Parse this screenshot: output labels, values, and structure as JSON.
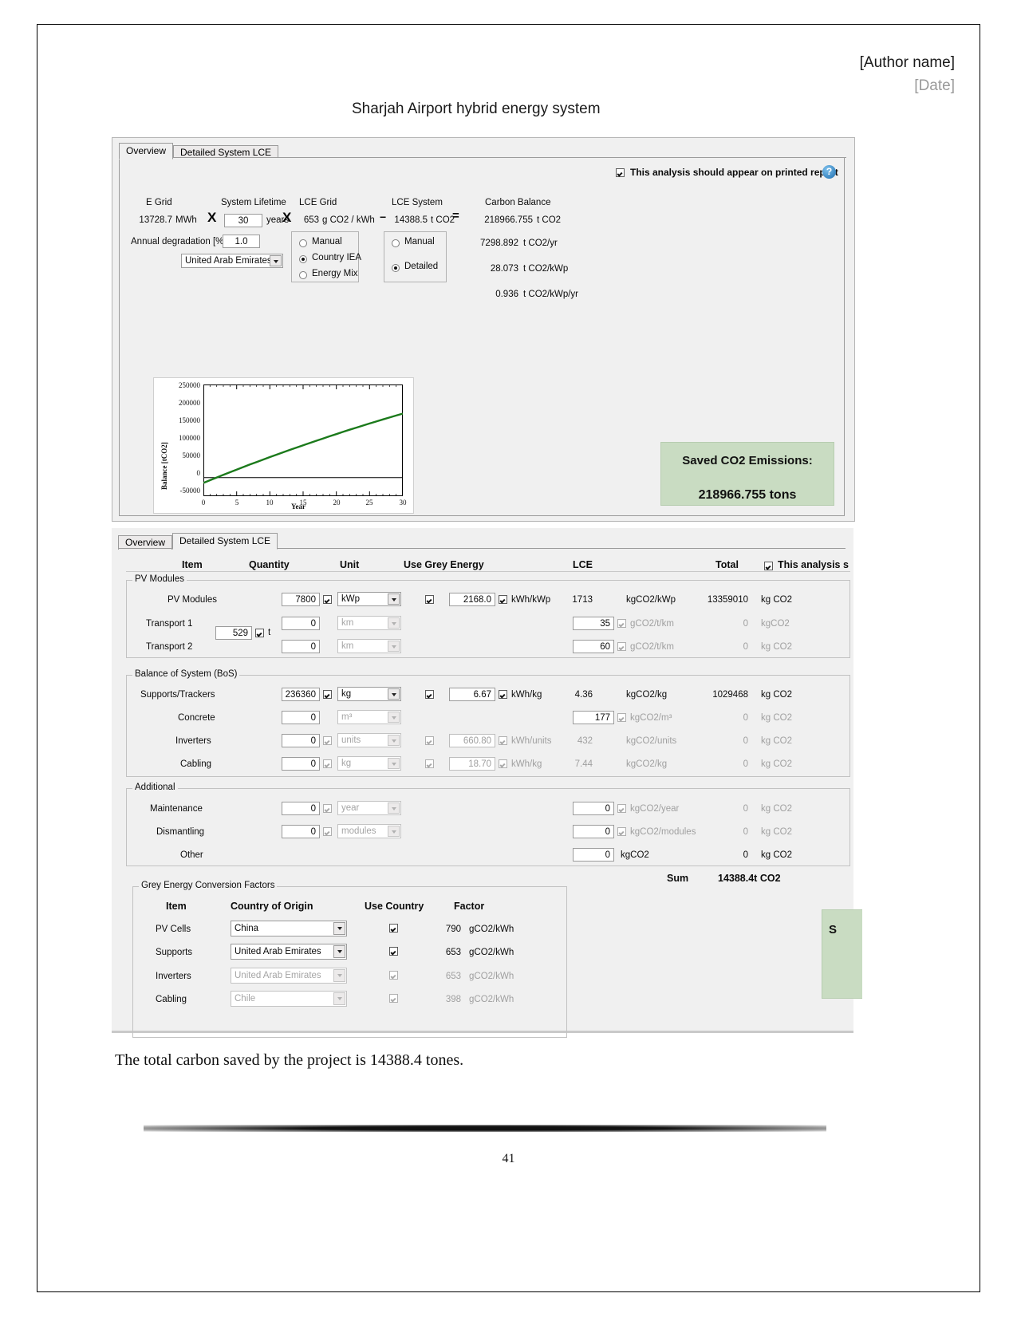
{
  "document": {
    "author": "[Author name]",
    "date": "[Date]",
    "title": "Sharjah Airport hybrid energy system",
    "caption": "The total carbon saved by the project is 14388.4 tones.",
    "page_number": "41"
  },
  "overview_panel": {
    "tabs": [
      {
        "label": "Overview",
        "active": true
      },
      {
        "label": "Detailed System LCE",
        "active": false
      }
    ],
    "print_checkbox": {
      "label": "This analysis should appear on printed report",
      "checked": true
    },
    "help_icon": "?",
    "fields": {
      "e_grid": {
        "label": "E Grid",
        "value": "13728.7",
        "unit": "MWh"
      },
      "op1": "X",
      "system_lifetime": {
        "label": "System Lifetime",
        "value": "30",
        "unit": "years"
      },
      "op2": "X",
      "lce_grid": {
        "label": "LCE Grid",
        "value": "653",
        "unit": "g CO2 / kWh"
      },
      "op3": "−",
      "lce_system": {
        "label": "LCE System",
        "value": "14388.5",
        "unit": "t CO2"
      },
      "op4": "=",
      "carbon_balance": {
        "label": "Carbon Balance",
        "value": "218966.755",
        "unit": "t CO2"
      },
      "annual_degradation": {
        "label": "Annual degradation [%] :",
        "value": "1.0"
      },
      "country": {
        "value": "United Arab Emirates"
      }
    },
    "lce_grid_mode": {
      "options": [
        "Manual",
        "Country IEA",
        "Energy Mix"
      ],
      "selected": "Country IEA"
    },
    "lce_system_mode": {
      "options": [
        "Manual",
        "Detailed"
      ],
      "selected": "Detailed"
    },
    "derived": [
      {
        "value": "7298.892",
        "unit": "t CO2/yr"
      },
      {
        "value": "28.073",
        "unit": "t CO2/kWp"
      },
      {
        "value": "0.936",
        "unit": "t CO2/kWp/yr"
      }
    ],
    "saved_box": {
      "title": "Saved CO2 Emissions:",
      "value": "218966.755 tons"
    }
  },
  "chart_data": {
    "type": "line",
    "title": "",
    "xlabel": "Year",
    "ylabel": "Balance [tCO2]",
    "xlim": [
      0,
      30
    ],
    "ylim": [
      -50000,
      250000
    ],
    "xticks": [
      "0",
      "5",
      "10",
      "15",
      "20",
      "25",
      "30"
    ],
    "yticks": [
      "-50000",
      "0",
      "50000",
      "100000",
      "150000",
      "200000",
      "250000"
    ],
    "grid": false,
    "legend": "none",
    "series": [
      {
        "name": "Carbon balance",
        "color": "#1b7a1b",
        "x": [
          0,
          1,
          2,
          3,
          4,
          5,
          6,
          7,
          8,
          9,
          10,
          11,
          12,
          13,
          14,
          15,
          16,
          17,
          18,
          19,
          20,
          21,
          22,
          23,
          24,
          25,
          26,
          27,
          28,
          29,
          30
        ],
        "y": [
          -14388,
          -7090,
          128,
          7266,
          14325,
          21305,
          28206,
          35029,
          41775,
          48444,
          55037,
          61554,
          67996,
          74364,
          80658,
          86879,
          93027,
          99103,
          105108,
          111042,
          116906,
          122700,
          128426,
          134083,
          139673,
          145196,
          150652,
          156043,
          161368,
          166629,
          171826
        ]
      }
    ]
  },
  "detail_panel": {
    "tabs": [
      {
        "label": "Overview",
        "active": false
      },
      {
        "label": "Detailed System LCE",
        "active": true
      }
    ],
    "columns": [
      "Item",
      "Quantity",
      "Unit",
      "Use Grey Energy",
      "LCE",
      "Total"
    ],
    "print_checkbox": {
      "label": "This analysis s",
      "checked": true
    },
    "groups": [
      {
        "title": "PV Modules",
        "rows": [
          {
            "item": "PV Modules",
            "qty": "7800",
            "qty_cb": true,
            "unit": "kWp",
            "unit_dim": false,
            "grey_cb": true,
            "grey_val": "2168.0",
            "grey_unit_cb": true,
            "grey_unit": "kWh/kWp",
            "lce": "1713",
            "lce_boxed": false,
            "lce_cb": false,
            "lce_unit": "kgCO2/kWp",
            "total": "13359010",
            "total_unit": "kg CO2",
            "dim": false
          },
          {
            "item": "Transport 1",
            "qty": "0",
            "qty_cb": false,
            "unit": "km",
            "unit_dim": true,
            "grey_cb": null,
            "grey_val": "",
            "grey_unit_cb": null,
            "grey_unit": "",
            "lce": "35",
            "lce_boxed": true,
            "lce_cb": true,
            "lce_unit": "gCO2/t/km",
            "total": "0",
            "total_unit": "kgCO2",
            "dim": true,
            "extra_qty": "529",
            "extra_cb": true,
            "extra_unit": "t"
          },
          {
            "item": "Transport 2",
            "qty": "0",
            "qty_cb": false,
            "unit": "km",
            "unit_dim": true,
            "grey_cb": null,
            "grey_val": "",
            "grey_unit_cb": null,
            "grey_unit": "",
            "lce": "60",
            "lce_boxed": true,
            "lce_cb": true,
            "lce_unit": "gCO2/t/km",
            "total": "0",
            "total_unit": "kg CO2",
            "dim": true
          }
        ]
      },
      {
        "title": "Balance of System (BoS)",
        "rows": [
          {
            "item": "Supports/Trackers",
            "qty": "236360",
            "qty_cb": true,
            "unit": "kg",
            "unit_dim": false,
            "grey_cb": true,
            "grey_val": "6.67",
            "grey_unit_cb": true,
            "grey_unit": "kWh/kg",
            "lce": "4.36",
            "lce_boxed": false,
            "lce_cb": false,
            "lce_unit": "kgCO2/kg",
            "total": "1029468",
            "total_unit": "kg CO2",
            "dim": false
          },
          {
            "item": "Concrete",
            "qty": "0",
            "qty_cb": false,
            "unit": "m³",
            "unit_dim": true,
            "grey_cb": null,
            "grey_val": "",
            "grey_unit_cb": null,
            "grey_unit": "",
            "lce": "177",
            "lce_boxed": true,
            "lce_cb": true,
            "lce_unit": "kgCO2/m³",
            "total": "0",
            "total_unit": "kg CO2",
            "dim": true
          },
          {
            "item": "Inverters",
            "qty": "0",
            "qty_cb": true,
            "unit": "units",
            "unit_dim": true,
            "grey_cb": true,
            "grey_val": "660.80",
            "grey_unit_cb": true,
            "grey_unit": "kWh/units",
            "lce": "432",
            "lce_boxed": false,
            "lce_cb": false,
            "lce_unit": "kgCO2/units",
            "total": "0",
            "total_unit": "kg CO2",
            "dim": true
          },
          {
            "item": "Cabling",
            "qty": "0",
            "qty_cb": true,
            "unit": "kg",
            "unit_dim": true,
            "grey_cb": true,
            "grey_val": "18.70",
            "grey_unit_cb": true,
            "grey_unit": "kWh/kg",
            "lce": "7.44",
            "lce_boxed": false,
            "lce_cb": false,
            "lce_unit": "kgCO2/kg",
            "total": "0",
            "total_unit": "kg CO2",
            "dim": true
          }
        ]
      },
      {
        "title": "Additional",
        "rows": [
          {
            "item": "Maintenance",
            "qty": "0",
            "qty_cb": true,
            "unit": "year",
            "unit_dim": true,
            "grey_cb": null,
            "grey_val": "",
            "grey_unit_cb": null,
            "grey_unit": "",
            "lce": "0",
            "lce_boxed": true,
            "lce_cb": true,
            "lce_unit": "kgCO2/year",
            "total": "0",
            "total_unit": "kg CO2",
            "dim": true
          },
          {
            "item": "Dismantling",
            "qty": "0",
            "qty_cb": true,
            "unit": "modules",
            "unit_dim": true,
            "grey_cb": null,
            "grey_val": "",
            "grey_unit_cb": null,
            "grey_unit": "",
            "lce": "0",
            "lce_boxed": true,
            "lce_cb": true,
            "lce_unit": "kgCO2/modules",
            "total": "0",
            "total_unit": "kg CO2",
            "dim": true
          },
          {
            "item": "Other",
            "qty": "",
            "qty_cb": null,
            "unit": "",
            "unit_dim": true,
            "grey_cb": null,
            "grey_val": "",
            "grey_unit_cb": null,
            "grey_unit": "",
            "lce": "0",
            "lce_boxed": true,
            "lce_cb": false,
            "lce_unit": "kgCO2",
            "total": "0",
            "total_unit": "kg CO2",
            "dim": false
          }
        ]
      }
    ],
    "sum": {
      "label": "Sum",
      "value": "14388.4t CO2"
    },
    "grey_factors": {
      "title": "Grey Energy Conversion Factors",
      "columns": [
        "Item",
        "Country of Origin",
        "Use Country",
        "Factor"
      ],
      "rows": [
        {
          "item": "PV Cells",
          "country": "China",
          "use": true,
          "factor": "790",
          "unit": "gCO2/kWh",
          "dim": false
        },
        {
          "item": "Supports",
          "country": "United Arab Emirates",
          "use": true,
          "factor": "653",
          "unit": "gCO2/kWh",
          "dim": false
        },
        {
          "item": "Inverters",
          "country": "United Arab Emirates",
          "use": true,
          "factor": "653",
          "unit": "gCO2/kWh",
          "dim": true
        },
        {
          "item": "Cabling",
          "country": "Chile",
          "use": true,
          "factor": "398",
          "unit": "gCO2/kWh",
          "dim": true
        }
      ]
    },
    "partial_green_letter": "S"
  }
}
